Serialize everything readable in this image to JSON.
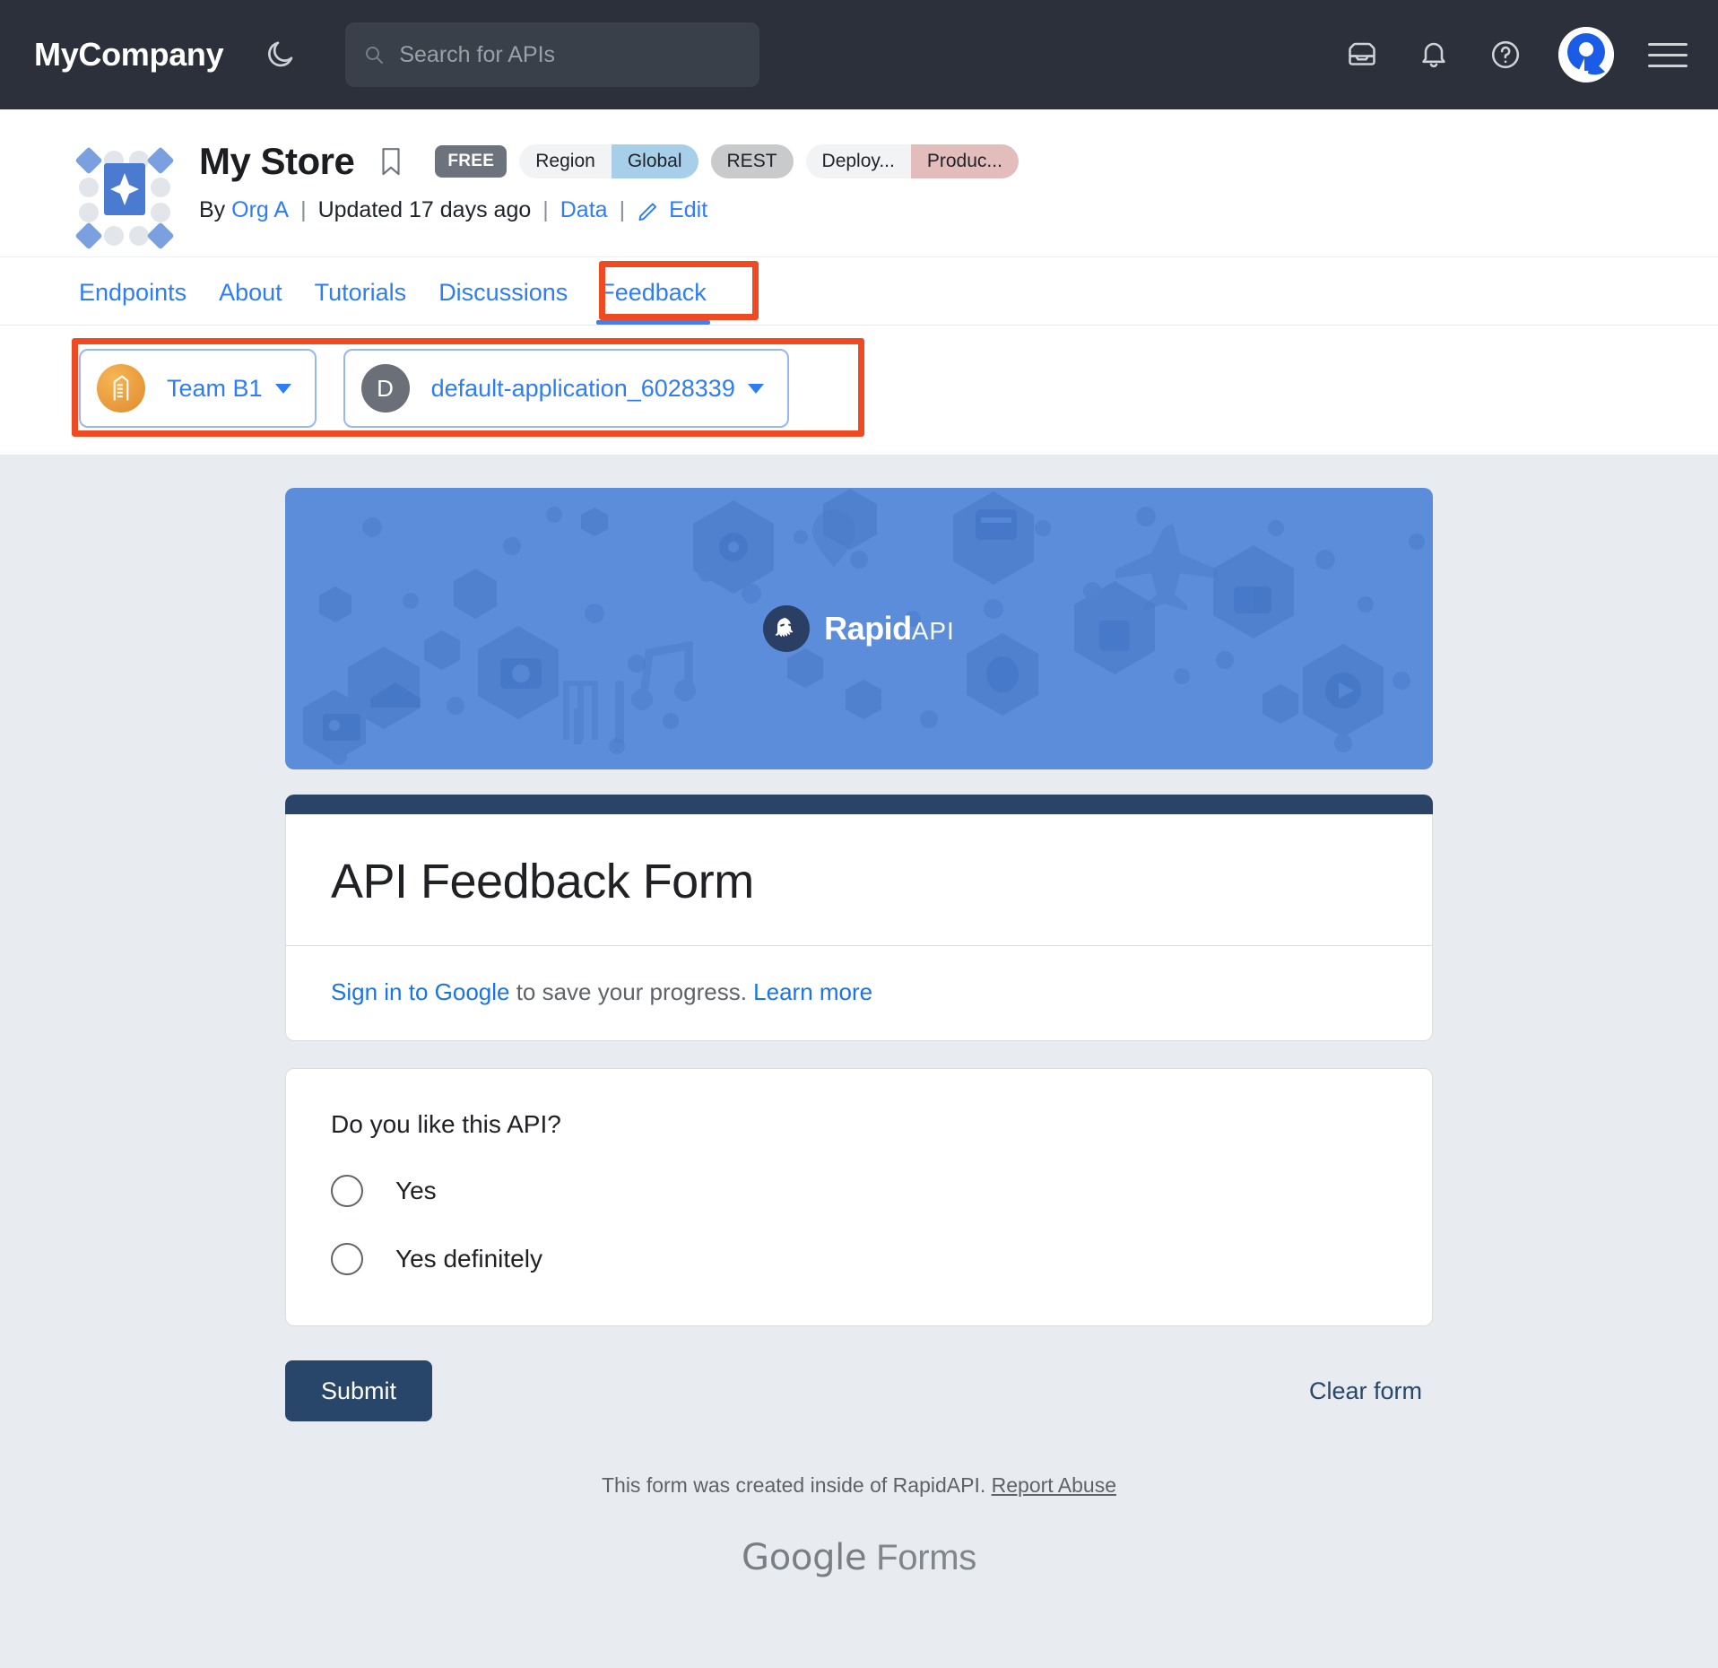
{
  "topnav": {
    "brand": "MyCompany",
    "theme_toggle_icon": "moon-icon",
    "search": {
      "placeholder": "Search for APIs",
      "icon": "search-icon"
    },
    "icons": [
      "inbox-icon",
      "bell-icon",
      "help-circle-icon",
      "user-avatar",
      "hamburger-menu-icon"
    ],
    "avatar_letter": "R"
  },
  "api_header": {
    "logo_icon": "api-star-logo",
    "name": "My Store",
    "bookmark_icon": "bookmark-icon",
    "badges": {
      "free": "FREE",
      "region_label": "Region",
      "region_value": "Global",
      "protocol": "REST",
      "deploy_label": "Deploy...",
      "deploy_value": "Produc..."
    },
    "by_prefix": "By",
    "org": "Org A",
    "updated": "Updated 17 days ago",
    "data_link": "Data",
    "edit_link": "Edit",
    "edit_icon": "pencil-icon",
    "separator": "|"
  },
  "tabs": [
    {
      "label": "Endpoints",
      "active": false
    },
    {
      "label": "About",
      "active": false
    },
    {
      "label": "Tutorials",
      "active": false
    },
    {
      "label": "Discussions",
      "active": false
    },
    {
      "label": "Feedback",
      "active": true
    }
  ],
  "selectors": {
    "team": {
      "label": "Team B1",
      "icon": "building-icon"
    },
    "application": {
      "label": "default-application_6028339",
      "avatar_letter": "D"
    }
  },
  "annotations": {
    "highlight_color": "#f04a23",
    "boxes": [
      "feedback-tab-highlight",
      "selector-row-highlight"
    ]
  },
  "banner": {
    "logo_text": "Rapid",
    "logo_suffix": "API",
    "background_color": "#5b8ddb",
    "icon_names": [
      "cloud-icon",
      "eye-icon",
      "location-pin-icon",
      "chat-icon",
      "credit-card-icon",
      "facebook-icon",
      "airplane-icon",
      "image-icon",
      "camera-icon",
      "music-note-icon",
      "gamepad-icon",
      "robot-icon",
      "amazon-icon",
      "fork-knife-icon",
      "phone-icon",
      "lightbulb-head-icon",
      "play-icon"
    ]
  },
  "form": {
    "title": "API Feedback Form",
    "signin": {
      "link": "Sign in to Google",
      "text": " to save your progress. ",
      "learn_more": "Learn more"
    },
    "question": "Do you like this API?",
    "options": [
      "Yes",
      "Yes definitely"
    ],
    "submit_label": "Submit",
    "clear_label": "Clear form",
    "footnote_text": "This form was created inside of RapidAPI. ",
    "footnote_link": "Report Abuse",
    "provider_brand": "Google",
    "provider_product": " Forms",
    "submit_color": "#284669"
  }
}
